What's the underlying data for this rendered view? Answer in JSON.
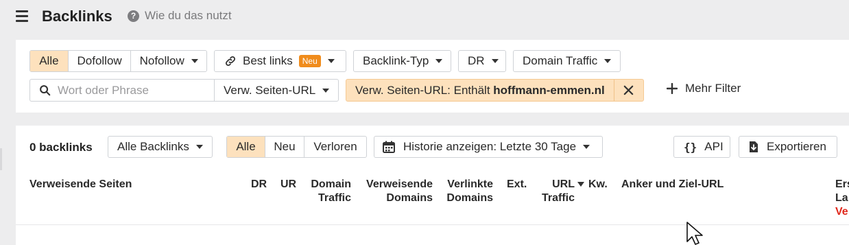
{
  "header": {
    "title": "Backlinks",
    "help_text": "Wie du das nutzt"
  },
  "filters_row1": {
    "mode_tabs": [
      {
        "label": "Alle",
        "active": true
      },
      {
        "label": "Dofollow",
        "active": false
      },
      {
        "label": "Nofollow",
        "active": false
      }
    ],
    "best_links": {
      "label": "Best links",
      "badge": "Neu"
    },
    "backlink_type": "Backlink-Typ",
    "dr": "DR",
    "domain_traffic": "Domain Traffic"
  },
  "filters_row2": {
    "search_placeholder": "Wort oder Phrase",
    "search_scope": "Verw. Seiten-URL",
    "active_filter": {
      "prefix": "Verw. Seiten-URL: Enthält ",
      "value": "hoffmann-emmen.nl"
    },
    "more_filter": "Mehr Filter"
  },
  "results_bar": {
    "count": "0 backlinks",
    "scope": "Alle Backlinks",
    "status_tabs": [
      {
        "label": "Alle",
        "active": true
      },
      {
        "label": "Neu",
        "active": false
      },
      {
        "label": "Verloren",
        "active": false
      }
    ],
    "history": "Historie anzeigen: Letzte 30 Tage",
    "api": "API",
    "export": "Exportieren"
  },
  "table": {
    "headers": {
      "referring_pages": "Verweisende Seiten",
      "dr": "DR",
      "ur": "UR",
      "domain_traffic_1": "Domain",
      "domain_traffic_2": "Traffic",
      "ref_domains_1": "Verweisende",
      "ref_domains_2": "Domains",
      "linked_domains_1": "Verlinkte",
      "linked_domains_2": "Domains",
      "ext": "Ext.",
      "url_traffic_1": "URL",
      "url_traffic_2": "Traffic",
      "kw": "Kw.",
      "anchor": "Anker und Ziel-URL",
      "first_1": "Ers",
      "first_2": "La",
      "first_3": "Ve"
    }
  },
  "colors": {
    "accent_active": "#fde1bd",
    "badge": "#f08c1c",
    "lost_red": "#e0281c"
  }
}
